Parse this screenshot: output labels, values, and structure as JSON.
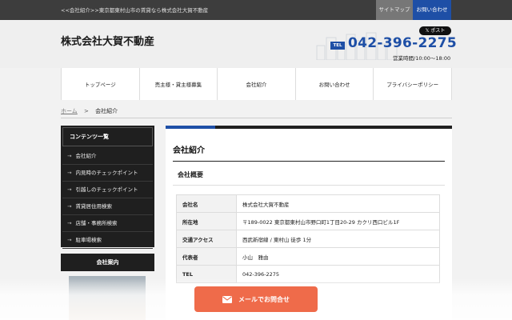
{
  "topbar": {
    "breadcrumb": "<<会社紹介>>東京都東村山市の賃貸なら株式会社大賀不動産",
    "sitemap": "サイトマップ",
    "contact": "お問い合わせ"
  },
  "header": {
    "logo": "株式会社大賀不動産",
    "post_button": "𝕏 ポスト",
    "tel_label": "TEL",
    "tel_number": "042-396-2275",
    "hours": "営業時間/10:00～18:00"
  },
  "nav": {
    "items": [
      "トップページ",
      "売主様・貸主様募集",
      "会社紹介",
      "お問い合わせ",
      "プライバシーポリシー"
    ]
  },
  "breadcrumb": {
    "home": "ホーム",
    "separator": ">",
    "current": "会社紹介"
  },
  "sidebar": {
    "heading": "コンテンツ一覧",
    "arrow": "→",
    "items": [
      "会社紹介",
      "内見時のチェックポイント",
      "引越しのチェックポイント",
      "賃貸居住用検索",
      "店舗・事務所検索",
      "駐車場検索"
    ],
    "company_heading": "会社案内"
  },
  "main": {
    "title": "会社紹介",
    "subtitle": "会社概要",
    "rows": [
      {
        "key": "会社名",
        "value": "株式会社大賀不動産"
      },
      {
        "key": "所在地",
        "value": "〒189-0022 東京都東村山市野口町1丁目20-29 カクリ西口ビル1F"
      },
      {
        "key": "交通アクセス",
        "value": "西武新宿線 / 東村山 徒歩 1分"
      },
      {
        "key": "代表者",
        "value": "小山　雅由"
      },
      {
        "key": "TEL",
        "value": "042-396-2275"
      }
    ]
  },
  "cta": {
    "label": "メールでお問合せ"
  },
  "colors": {
    "accent": "#1e4fa6",
    "cta": "#ef6b4a",
    "dark": "#1f1f1f"
  }
}
